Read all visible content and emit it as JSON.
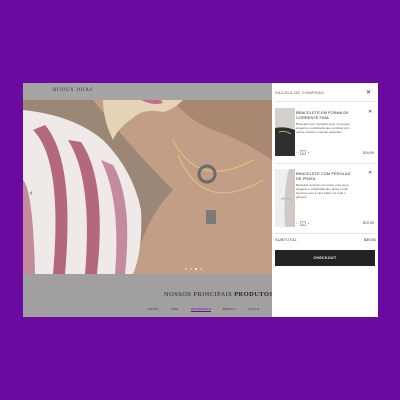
{
  "site": {
    "brand": "BIJOUX JOIAS",
    "section_title_prefix": "NOSSOS PRINCIPAIS",
    "section_title_bold": "PRODUTOS",
    "filters": [
      "TODOS",
      "ANEL",
      "BRACELETE",
      "BRINCO",
      "COLAR"
    ],
    "active_filter": "BRACELETE",
    "carousel_arrow": "‹",
    "carousel_slides": 4,
    "carousel_active_index": 2
  },
  "cart": {
    "title": "SACOLA DE COMPRAS",
    "close": "✕",
    "items": [
      {
        "name": "BRACELETE EM FORMA DE CORRENTE FINA",
        "description": "Bracelete com minúcias simp, uma peça elegante e sofisticada que combina com outros colares e marcas especiais",
        "price": "$19,99",
        "quantity": "1",
        "remove": "✕"
      },
      {
        "name": "BRACELETE COM PÉROLAS DE PRATA",
        "description": "Bracelete feminino em prata, uma peça elegante e sofisticada que deixa o tudo feminino com a cara sabor por tudo o glamour",
        "price": "$19,99",
        "quantity": "1",
        "remove": "✕"
      }
    ],
    "subtotal_label": "SUBTOTAL",
    "subtotal_value": "$39,98",
    "checkout_label": "CHECKOUT"
  }
}
